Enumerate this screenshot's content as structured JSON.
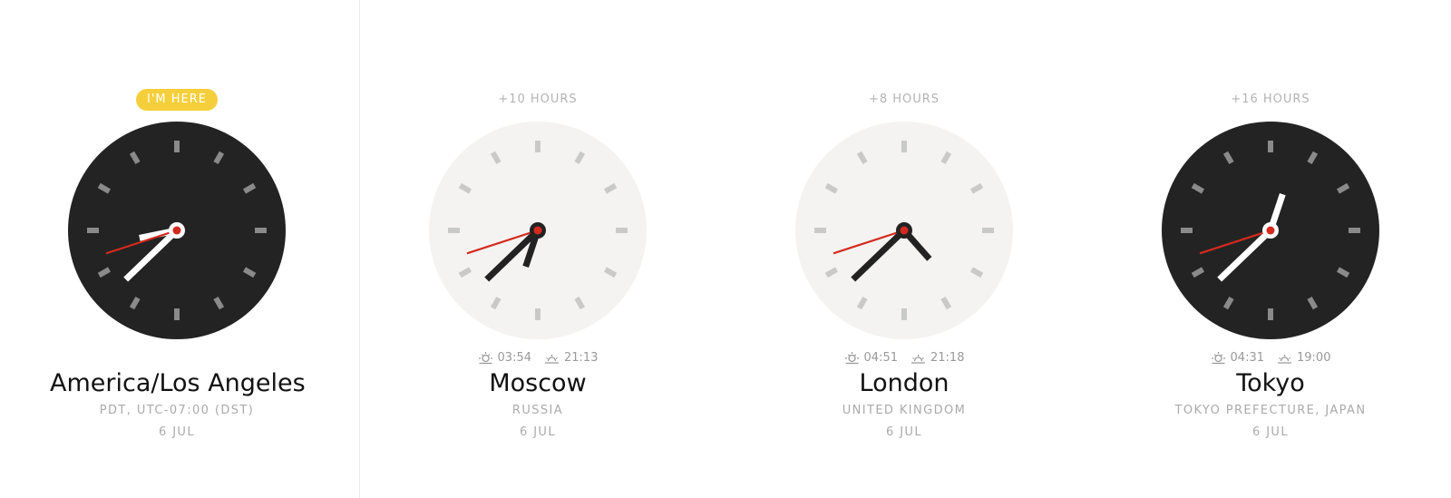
{
  "clocks": [
    {
      "badge": "I'M HERE",
      "offset_label": "",
      "city": "America/Los Angeles",
      "subtitle": "PDT, UTC-07:00 (DST)",
      "date": "6 JUL",
      "sunrise": "",
      "sunset": "",
      "theme": "dark",
      "time": {
        "hour": 20,
        "minute": 37,
        "second": 42
      }
    },
    {
      "badge": "",
      "offset_label": "+10 HOURS",
      "city": "Moscow",
      "subtitle": "RUSSIA",
      "date": "6 JUL",
      "sunrise": "03:54",
      "sunset": "21:13",
      "theme": "light",
      "time": {
        "hour": 6,
        "minute": 37,
        "second": 42
      }
    },
    {
      "badge": "",
      "offset_label": "+8 HOURS",
      "city": "London",
      "subtitle": "UNITED KINGDOM",
      "date": "6 JUL",
      "sunrise": "04:51",
      "sunset": "21:18",
      "theme": "light",
      "time": {
        "hour": 4,
        "minute": 37,
        "second": 42
      }
    },
    {
      "badge": "",
      "offset_label": "+16 HOURS",
      "city": "Tokyo",
      "subtitle": "TOKYO PREFECTURE, JAPAN",
      "date": "6 JUL",
      "sunrise": "04:31",
      "sunset": "19:00",
      "theme": "dark",
      "time": {
        "hour": 12,
        "minute": 37,
        "second": 42
      }
    }
  ],
  "colors": {
    "dark_face": "#232323",
    "light_face": "#f4f3f1",
    "second_hand": "#d42a1e",
    "badge": "#f5cf3b"
  },
  "icons": {
    "sunrise": "sunrise-icon",
    "sunset": "sunset-icon"
  }
}
